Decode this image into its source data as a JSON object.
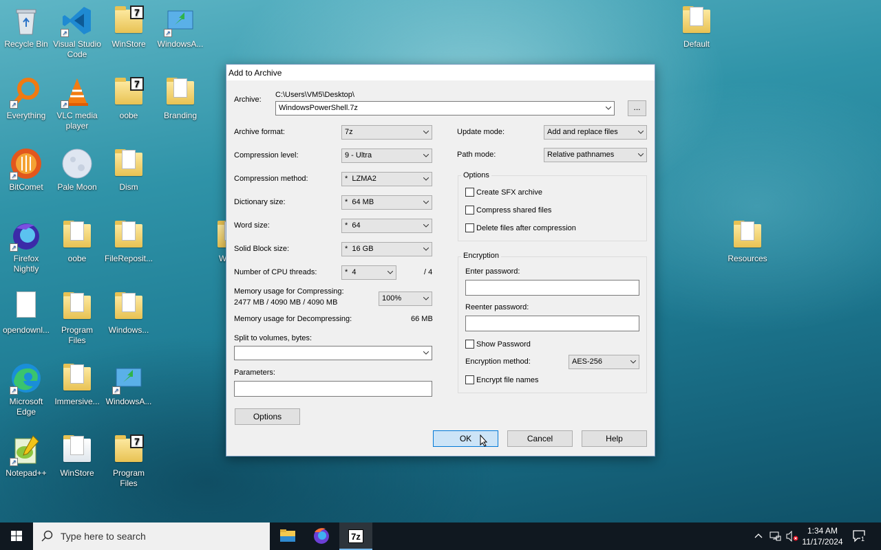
{
  "desktop_icons": [
    {
      "label": "Recycle Bin",
      "icon": "recycle-bin-icon"
    },
    {
      "label": "Visual Studio Code",
      "icon": "vscode-icon"
    },
    {
      "label": "WinStore",
      "icon": "folder-7z-icon"
    },
    {
      "label": "WindowsA...",
      "icon": "windows-app-icon"
    },
    {
      "label": "Default",
      "icon": "folder-doc-icon"
    },
    {
      "label": "Everything",
      "icon": "everything-search-icon"
    },
    {
      "label": "VLC media player",
      "icon": "vlc-icon"
    },
    {
      "label": "oobe",
      "icon": "folder-7z-icon"
    },
    {
      "label": "Branding",
      "icon": "folder-doc-icon"
    },
    {
      "label": "BitComet",
      "icon": "bitcomet-icon"
    },
    {
      "label": "Pale Moon",
      "icon": "pale-moon-icon"
    },
    {
      "label": "Dism",
      "icon": "folder-doc-icon"
    },
    {
      "label": "Firefox Nightly",
      "icon": "firefox-nightly-icon"
    },
    {
      "label": "oobe",
      "icon": "folder-doc-icon"
    },
    {
      "label": "FileReposit...",
      "icon": "folder-doc-icon"
    },
    {
      "label": "Wi Def",
      "icon": "folder-doc-icon"
    },
    {
      "label": "Resources",
      "icon": "folder-doc-icon"
    },
    {
      "label": "opendownl...",
      "icon": "blank-file-icon"
    },
    {
      "label": "Program Files",
      "icon": "folder-doc-icon"
    },
    {
      "label": "Windows...",
      "icon": "folder-doc-icon"
    },
    {
      "label": "Microsoft Edge",
      "icon": "edge-icon"
    },
    {
      "label": "Immersive...",
      "icon": "folder-doc-icon"
    },
    {
      "label": "WindowsA...",
      "icon": "windows-app-icon"
    },
    {
      "label": "Notepad++",
      "icon": "notepad-plus-plus-icon"
    },
    {
      "label": "WinStore",
      "icon": "folder-doc-icon"
    },
    {
      "label": "Program Files",
      "icon": "folder-7z-icon"
    }
  ],
  "dialog": {
    "title": "Add to Archive",
    "archive_label": "Archive:",
    "archive_path": "C:\\Users\\VM5\\Desktop\\",
    "archive_name": "WindowsPowerShell.7z",
    "browse_label": "...",
    "left_fields": [
      {
        "label": "Archive format:",
        "value": "7z"
      },
      {
        "label": "Compression level:",
        "value": "9 - Ultra"
      },
      {
        "label": "Compression method:",
        "value": "*  LZMA2"
      },
      {
        "label": "Dictionary size:",
        "value": "*  64 MB"
      },
      {
        "label": "Word size:",
        "value": "*  64"
      },
      {
        "label": "Solid Block size:",
        "value": "*  16 GB"
      }
    ],
    "cpu_threads_label": "Number of CPU threads:",
    "cpu_threads_value": "*  4",
    "cpu_threads_max": "/ 4",
    "mem_compress_label": "Memory usage for Compressing:",
    "mem_compress_value": "2477 MB / 4090 MB / 4090 MB",
    "mem_compress_percent": "100%",
    "mem_decompress_label": "Memory usage for Decompressing:",
    "mem_decompress_value": "66 MB",
    "split_label": "Split to volumes, bytes:",
    "split_value": "",
    "parameters_label": "Parameters:",
    "parameters_value": "",
    "options_button": "Options",
    "update_mode_label": "Update mode:",
    "update_mode_value": "Add and replace files",
    "path_mode_label": "Path mode:",
    "path_mode_value": "Relative pathnames",
    "options_group_title": "Options",
    "option_checks": [
      {
        "label": "Create SFX archive",
        "checked": false
      },
      {
        "label": "Compress shared files",
        "checked": false
      },
      {
        "label": "Delete files after compression",
        "checked": false
      }
    ],
    "encryption_group_title": "Encryption",
    "enter_password_label": "Enter password:",
    "reenter_password_label": "Reenter password:",
    "show_password_label": "Show Password",
    "encryption_method_label": "Encryption method:",
    "encryption_method_value": "AES-256",
    "encrypt_names_label": "Encrypt file names",
    "ok_button": "OK",
    "cancel_button": "Cancel",
    "help_button": "Help"
  },
  "taskbar": {
    "search_placeholder": "Type here to search",
    "pinned": [
      {
        "icon": "file-explorer-icon"
      },
      {
        "icon": "firefox-icon"
      },
      {
        "icon": "7zip-icon",
        "label": "7z",
        "active": true
      }
    ],
    "time": "1:34 AM",
    "date": "11/17/2024",
    "notification_count": "1"
  }
}
